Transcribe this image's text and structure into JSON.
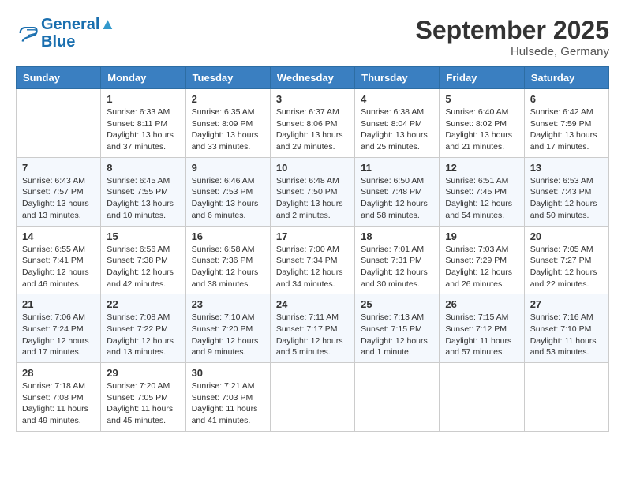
{
  "header": {
    "logo_line1": "General",
    "logo_line2": "Blue",
    "month": "September 2025",
    "location": "Hulsede, Germany"
  },
  "weekdays": [
    "Sunday",
    "Monday",
    "Tuesday",
    "Wednesday",
    "Thursday",
    "Friday",
    "Saturday"
  ],
  "weeks": [
    [
      {
        "day": "",
        "info": ""
      },
      {
        "day": "1",
        "info": "Sunrise: 6:33 AM\nSunset: 8:11 PM\nDaylight: 13 hours\nand 37 minutes."
      },
      {
        "day": "2",
        "info": "Sunrise: 6:35 AM\nSunset: 8:09 PM\nDaylight: 13 hours\nand 33 minutes."
      },
      {
        "day": "3",
        "info": "Sunrise: 6:37 AM\nSunset: 8:06 PM\nDaylight: 13 hours\nand 29 minutes."
      },
      {
        "day": "4",
        "info": "Sunrise: 6:38 AM\nSunset: 8:04 PM\nDaylight: 13 hours\nand 25 minutes."
      },
      {
        "day": "5",
        "info": "Sunrise: 6:40 AM\nSunset: 8:02 PM\nDaylight: 13 hours\nand 21 minutes."
      },
      {
        "day": "6",
        "info": "Sunrise: 6:42 AM\nSunset: 7:59 PM\nDaylight: 13 hours\nand 17 minutes."
      }
    ],
    [
      {
        "day": "7",
        "info": "Sunrise: 6:43 AM\nSunset: 7:57 PM\nDaylight: 13 hours\nand 13 minutes."
      },
      {
        "day": "8",
        "info": "Sunrise: 6:45 AM\nSunset: 7:55 PM\nDaylight: 13 hours\nand 10 minutes."
      },
      {
        "day": "9",
        "info": "Sunrise: 6:46 AM\nSunset: 7:53 PM\nDaylight: 13 hours\nand 6 minutes."
      },
      {
        "day": "10",
        "info": "Sunrise: 6:48 AM\nSunset: 7:50 PM\nDaylight: 13 hours\nand 2 minutes."
      },
      {
        "day": "11",
        "info": "Sunrise: 6:50 AM\nSunset: 7:48 PM\nDaylight: 12 hours\nand 58 minutes."
      },
      {
        "day": "12",
        "info": "Sunrise: 6:51 AM\nSunset: 7:45 PM\nDaylight: 12 hours\nand 54 minutes."
      },
      {
        "day": "13",
        "info": "Sunrise: 6:53 AM\nSunset: 7:43 PM\nDaylight: 12 hours\nand 50 minutes."
      }
    ],
    [
      {
        "day": "14",
        "info": "Sunrise: 6:55 AM\nSunset: 7:41 PM\nDaylight: 12 hours\nand 46 minutes."
      },
      {
        "day": "15",
        "info": "Sunrise: 6:56 AM\nSunset: 7:38 PM\nDaylight: 12 hours\nand 42 minutes."
      },
      {
        "day": "16",
        "info": "Sunrise: 6:58 AM\nSunset: 7:36 PM\nDaylight: 12 hours\nand 38 minutes."
      },
      {
        "day": "17",
        "info": "Sunrise: 7:00 AM\nSunset: 7:34 PM\nDaylight: 12 hours\nand 34 minutes."
      },
      {
        "day": "18",
        "info": "Sunrise: 7:01 AM\nSunset: 7:31 PM\nDaylight: 12 hours\nand 30 minutes."
      },
      {
        "day": "19",
        "info": "Sunrise: 7:03 AM\nSunset: 7:29 PM\nDaylight: 12 hours\nand 26 minutes."
      },
      {
        "day": "20",
        "info": "Sunrise: 7:05 AM\nSunset: 7:27 PM\nDaylight: 12 hours\nand 22 minutes."
      }
    ],
    [
      {
        "day": "21",
        "info": "Sunrise: 7:06 AM\nSunset: 7:24 PM\nDaylight: 12 hours\nand 17 minutes."
      },
      {
        "day": "22",
        "info": "Sunrise: 7:08 AM\nSunset: 7:22 PM\nDaylight: 12 hours\nand 13 minutes."
      },
      {
        "day": "23",
        "info": "Sunrise: 7:10 AM\nSunset: 7:20 PM\nDaylight: 12 hours\nand 9 minutes."
      },
      {
        "day": "24",
        "info": "Sunrise: 7:11 AM\nSunset: 7:17 PM\nDaylight: 12 hours\nand 5 minutes."
      },
      {
        "day": "25",
        "info": "Sunrise: 7:13 AM\nSunset: 7:15 PM\nDaylight: 12 hours\nand 1 minute."
      },
      {
        "day": "26",
        "info": "Sunrise: 7:15 AM\nSunset: 7:12 PM\nDaylight: 11 hours\nand 57 minutes."
      },
      {
        "day": "27",
        "info": "Sunrise: 7:16 AM\nSunset: 7:10 PM\nDaylight: 11 hours\nand 53 minutes."
      }
    ],
    [
      {
        "day": "28",
        "info": "Sunrise: 7:18 AM\nSunset: 7:08 PM\nDaylight: 11 hours\nand 49 minutes."
      },
      {
        "day": "29",
        "info": "Sunrise: 7:20 AM\nSunset: 7:05 PM\nDaylight: 11 hours\nand 45 minutes."
      },
      {
        "day": "30",
        "info": "Sunrise: 7:21 AM\nSunset: 7:03 PM\nDaylight: 11 hours\nand 41 minutes."
      },
      {
        "day": "",
        "info": ""
      },
      {
        "day": "",
        "info": ""
      },
      {
        "day": "",
        "info": ""
      },
      {
        "day": "",
        "info": ""
      }
    ]
  ]
}
